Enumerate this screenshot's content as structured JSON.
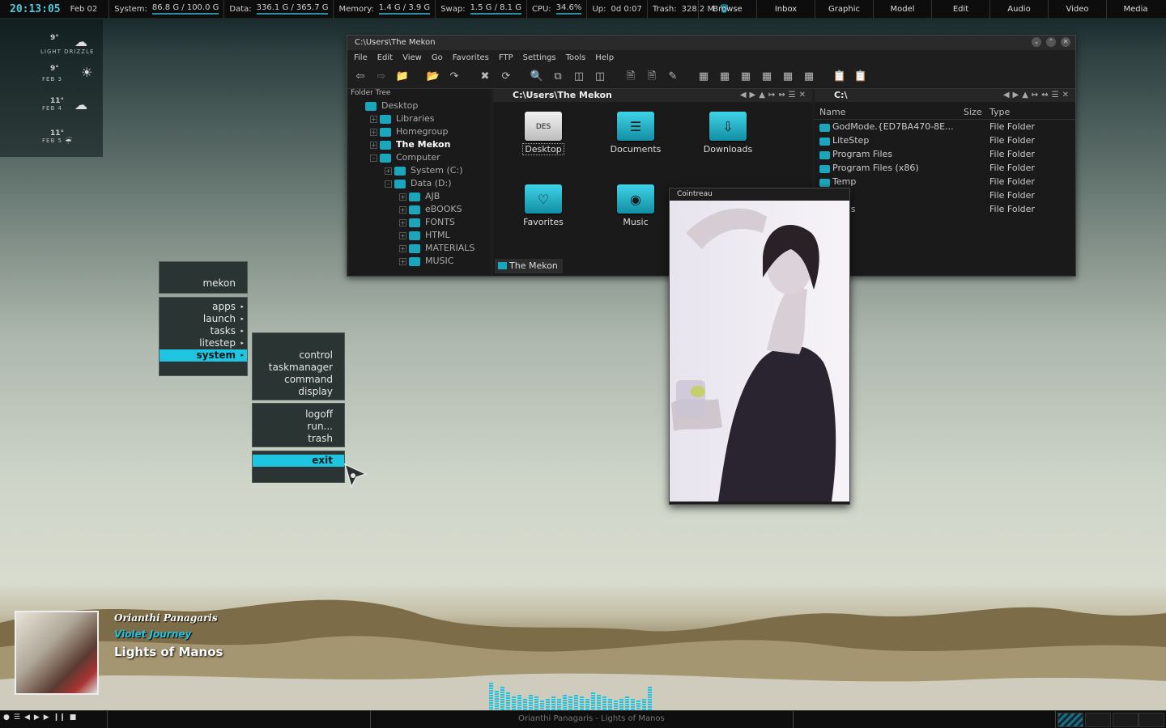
{
  "topbar": {
    "clock": "20:13:05",
    "date": "Feb 02",
    "stats": [
      {
        "label": "System:",
        "value": "86.8 G / 100.0 G"
      },
      {
        "label": "Data:",
        "value": "336.1 G / 365.7 G"
      },
      {
        "label": "Memory:",
        "value": "1.4 G / 3.9 G"
      },
      {
        "label": "Swap:",
        "value": "1.5 G / 8.1 G"
      },
      {
        "label": "CPU:",
        "value": "34.6%"
      },
      {
        "label": "Up:",
        "value": "0d 0:07"
      },
      {
        "label": "Trash:",
        "value": "328.2 M"
      }
    ],
    "menus": [
      "Browse",
      "Inbox",
      "Graphic",
      "Model",
      "Edit",
      "Audio",
      "Video",
      "Media"
    ]
  },
  "weather": {
    "days": [
      {
        "temp": "9°",
        "label": "LIGHT DRIZZLE",
        "icon": "rain-cloud-icon"
      },
      {
        "temp": "9°",
        "label": "FEB 3",
        "icon": "sun-icon"
      },
      {
        "temp": "11°",
        "label": "FEB 4",
        "icon": "rain-cloud-icon"
      },
      {
        "temp": "11°",
        "label": "FEB 5",
        "icon": "rain-icon"
      }
    ]
  },
  "menu": {
    "header": "mekon",
    "main": [
      "apps",
      "launch",
      "tasks",
      "litestep",
      "system"
    ],
    "active": "system",
    "sub1": [
      "control",
      "taskmanager",
      "command",
      "display"
    ],
    "sub2": [
      "logoff",
      "run...",
      "trash"
    ],
    "sub3": [
      "exit"
    ]
  },
  "explorer": {
    "title": "C:\\Users\\The Mekon",
    "menubar": [
      "File",
      "Edit",
      "View",
      "Go",
      "Favorites",
      "FTP",
      "Settings",
      "Tools",
      "Help"
    ],
    "tree_header": "Folder Tree",
    "tree": [
      {
        "label": "Desktop",
        "indent": 0,
        "exp": ""
      },
      {
        "label": "Libraries",
        "indent": 1,
        "exp": "+"
      },
      {
        "label": "Homegroup",
        "indent": 1,
        "exp": "+"
      },
      {
        "label": "The Mekon",
        "indent": 1,
        "exp": "+",
        "bold": true
      },
      {
        "label": "Computer",
        "indent": 1,
        "exp": "-"
      },
      {
        "label": "System (C:)",
        "indent": 2,
        "exp": "+"
      },
      {
        "label": "Data (D:)",
        "indent": 2,
        "exp": "-"
      },
      {
        "label": "AJB",
        "indent": 3,
        "exp": "+"
      },
      {
        "label": "eBOOKS",
        "indent": 3,
        "exp": "+"
      },
      {
        "label": "FONTS",
        "indent": 3,
        "exp": "+"
      },
      {
        "label": "HTML",
        "indent": 3,
        "exp": "+"
      },
      {
        "label": "MATERIALS",
        "indent": 3,
        "exp": "+"
      },
      {
        "label": "MUSIC",
        "indent": 3,
        "exp": "+"
      }
    ],
    "mid_path": "C:\\Users\\The Mekon",
    "mid_icons": [
      {
        "label": "Desktop",
        "style": "white",
        "glyph": "DES",
        "selected": true
      },
      {
        "label": "Documents",
        "style": "teal",
        "glyph": "☰",
        "selected": false
      },
      {
        "label": "Downloads",
        "style": "teal",
        "glyph": "⇩",
        "selected": false
      },
      {
        "label": "Favorites",
        "style": "teal",
        "glyph": "♡",
        "selected": false
      },
      {
        "label": "Music",
        "style": "teal",
        "glyph": "◉",
        "selected": false
      }
    ],
    "mid_tab": "The Mekon",
    "right_path": "C:\\",
    "right_columns": {
      "name": "Name",
      "size": "Size",
      "type": "Type"
    },
    "right_rows": [
      {
        "name": "GodMode.{ED7BA470-8E...",
        "type": "File Folder"
      },
      {
        "name": "LiteStep",
        "type": "File Folder"
      },
      {
        "name": "Program Files",
        "type": "File Folder"
      },
      {
        "name": "Program Files (x86)",
        "type": "File Folder"
      },
      {
        "name": "Temp",
        "type": "File Folder"
      },
      {
        "name": "s",
        "type": "File Folder"
      },
      {
        "name": "dows",
        "type": "File Folder"
      }
    ]
  },
  "photo": {
    "title": "Cointreau"
  },
  "player": {
    "artist": "Orianthi Panagaris",
    "album": "Violet Journey",
    "track": "Lights of Manos",
    "ticker": "Orianthi Panagaris - Lights of Manos",
    "eq_levels": [
      0.7,
      0.5,
      0.6,
      0.45,
      0.35,
      0.4,
      0.3,
      0.4,
      0.35,
      0.25,
      0.3,
      0.35,
      0.3,
      0.4,
      0.35,
      0.4,
      0.35,
      0.3,
      0.45,
      0.4,
      0.35,
      0.3,
      0.25,
      0.3,
      0.35,
      0.3,
      0.25,
      0.3,
      0.6
    ]
  }
}
